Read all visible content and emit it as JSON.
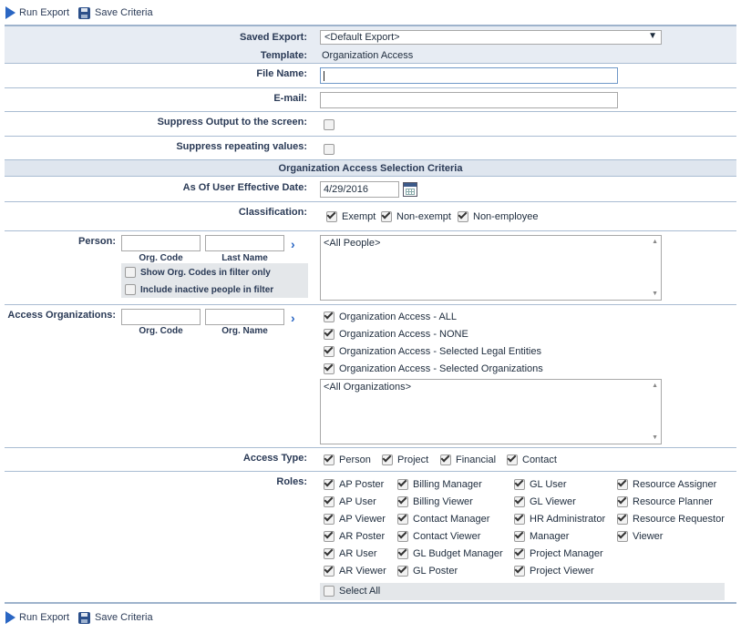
{
  "toolbar": {
    "run_export": "Run Export",
    "save_criteria": "Save Criteria"
  },
  "saved_export": {
    "label": "Saved Export:",
    "value": "<Default Export>"
  },
  "template": {
    "label": "Template:",
    "value": "Organization Access"
  },
  "file_name": {
    "label": "File Name:",
    "value": ""
  },
  "email": {
    "label": "E-mail:",
    "value": ""
  },
  "suppress_output": {
    "label": "Suppress Output to the screen:",
    "checked": false
  },
  "suppress_repeating": {
    "label": "Suppress repeating values:",
    "checked": false
  },
  "section_title": "Organization Access Selection Criteria",
  "effective_date": {
    "label": "As Of User Effective Date:",
    "value": "4/29/2016"
  },
  "classification": {
    "label": "Classification:",
    "options": [
      {
        "label": "Exempt",
        "checked": true
      },
      {
        "label": "Non-exempt",
        "checked": true
      },
      {
        "label": "Non-employee",
        "checked": true
      }
    ]
  },
  "person": {
    "label": "Person:",
    "org_code_label": "Org. Code",
    "last_name_label": "Last Name",
    "show_org_codes": "Show Org. Codes in filter only",
    "include_inactive": "Include inactive people in filter",
    "list_value": "<All People>"
  },
  "access_orgs": {
    "label": "Access Organizations:",
    "org_code_label": "Org. Code",
    "org_name_label": "Org. Name",
    "options": [
      {
        "label": "Organization Access - ALL",
        "checked": true
      },
      {
        "label": "Organization Access - NONE",
        "checked": true
      },
      {
        "label": "Organization Access - Selected Legal Entities",
        "checked": true
      },
      {
        "label": "Organization Access - Selected Organizations",
        "checked": true
      }
    ],
    "list_value": "<All Organizations>"
  },
  "access_type": {
    "label": "Access Type:",
    "options": [
      {
        "label": "Person",
        "checked": true
      },
      {
        "label": "Project",
        "checked": true
      },
      {
        "label": "Financial",
        "checked": true
      },
      {
        "label": "Contact",
        "checked": true
      }
    ]
  },
  "roles": {
    "label": "Roles:",
    "columns": [
      [
        "AP Poster",
        "AP User",
        "AP Viewer",
        "AR Poster",
        "AR User",
        "AR Viewer"
      ],
      [
        "Billing Manager",
        "Billing Viewer",
        "Contact Manager",
        "Contact Viewer",
        "GL Budget Manager",
        "GL Poster"
      ],
      [
        "GL User",
        "GL Viewer",
        "HR Administrator",
        "Manager",
        "Project Manager",
        "Project Viewer"
      ],
      [
        "Resource Assigner",
        "Resource Planner",
        "Resource Requestor",
        "Viewer"
      ]
    ],
    "select_all": "Select All"
  }
}
